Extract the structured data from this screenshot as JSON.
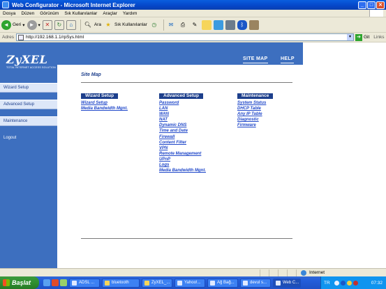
{
  "window": {
    "title": "Web Configurator - Microsoft Internet Explorer"
  },
  "menubar": [
    "Dosya",
    "Düzen",
    "Görünüm",
    "Sık Kullanılanlar",
    "Araçlar",
    "Yardım"
  ],
  "toolbar": {
    "back": "Geri",
    "search": "Ara",
    "favorites": "Sık Kullanılanlar"
  },
  "address": {
    "label": "Adres",
    "url": "http://192.168.1.1/rpSys.html",
    "go": "Git",
    "links": "Links"
  },
  "logo": {
    "brand": "ZyXEL",
    "tagline": "TOTAL INTERNET ACCESS SOLUTION"
  },
  "sidebar": {
    "items": [
      "Wizard Setup",
      "Advanced Setup",
      "Maintenance",
      "Logout"
    ]
  },
  "top_links": {
    "site_map": "SITE MAP",
    "help": "HELP"
  },
  "page": {
    "title": "Site Map",
    "columns": [
      {
        "heading": "Wizard Setup",
        "links": [
          "Wizard Setup",
          "Media Bandwidth Mgnt."
        ]
      },
      {
        "heading": "Advanced Setup",
        "links": [
          "Password",
          "LAN",
          "WAN",
          "NAT",
          "Dynamic DNS",
          "Time and Date",
          "Firewall",
          "Content Filter",
          "VPN",
          "Remote Management",
          "UPnP",
          "Logs",
          "Media Bandwidth Mgnt."
        ]
      },
      {
        "heading": "Maintenance",
        "links": [
          "System Status",
          "DHCP Table",
          "Any IP Table",
          "Diagnostic",
          "Firmware"
        ]
      }
    ]
  },
  "statusbar": {
    "zone": "Internet"
  },
  "taskbar": {
    "start": "Başlat",
    "tasks": [
      "ADSL ...",
      "bluetooth",
      "ZyXEL_...",
      "Yahoo!...",
      "Ağ Bağ...",
      "devul s...",
      "Web C..."
    ],
    "language": "TR",
    "clock": "07:32"
  },
  "colors": {
    "accent": "#3d6fbf",
    "heading_bg": "#1d3f8c",
    "link": "#1f47c9"
  }
}
